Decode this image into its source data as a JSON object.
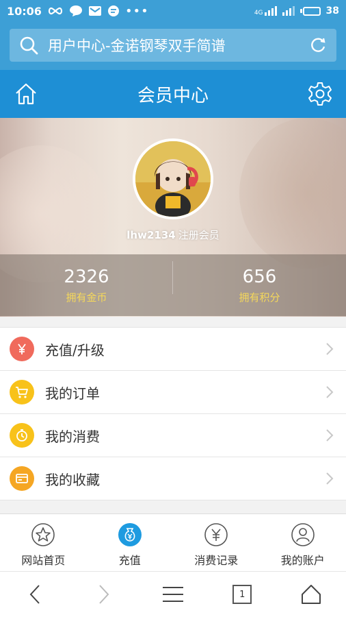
{
  "status_bar": {
    "time": "10:06",
    "network": "4G",
    "battery": "38",
    "battery_level": 0.38
  },
  "browser": {
    "url_title": "用户中心-金诺钢琴双手简谱"
  },
  "header": {
    "title": "会员中心"
  },
  "profile": {
    "username": "lhw2134",
    "role": "注册会员",
    "stats": [
      {
        "value": "2326",
        "label": "拥有金币"
      },
      {
        "value": "656",
        "label": "拥有积分"
      }
    ]
  },
  "menu": {
    "items": [
      {
        "label": "充值/升级",
        "icon": "yen-icon",
        "color": "#f06a5c"
      },
      {
        "label": "我的订单",
        "icon": "cart-icon",
        "color": "#f8c21a"
      },
      {
        "label": "我的消费",
        "icon": "stopwatch-icon",
        "color": "#f8c21a"
      },
      {
        "label": "我的收藏",
        "icon": "card-icon",
        "color": "#f5a623"
      }
    ]
  },
  "tabbar": {
    "items": [
      {
        "label": "网站首页",
        "icon": "star-icon"
      },
      {
        "label": "充值",
        "icon": "money-bag-icon",
        "active": true
      },
      {
        "label": "消费记录",
        "icon": "yen-circle-icon"
      },
      {
        "label": "我的账户",
        "icon": "user-icon"
      }
    ]
  },
  "navbar": {
    "page_count": "1"
  },
  "colors": {
    "status_bar": "#3d9fd6",
    "header": "#1e8fd5",
    "accent_gold": "#f5d85a",
    "active_tab": "#1e9be0"
  }
}
